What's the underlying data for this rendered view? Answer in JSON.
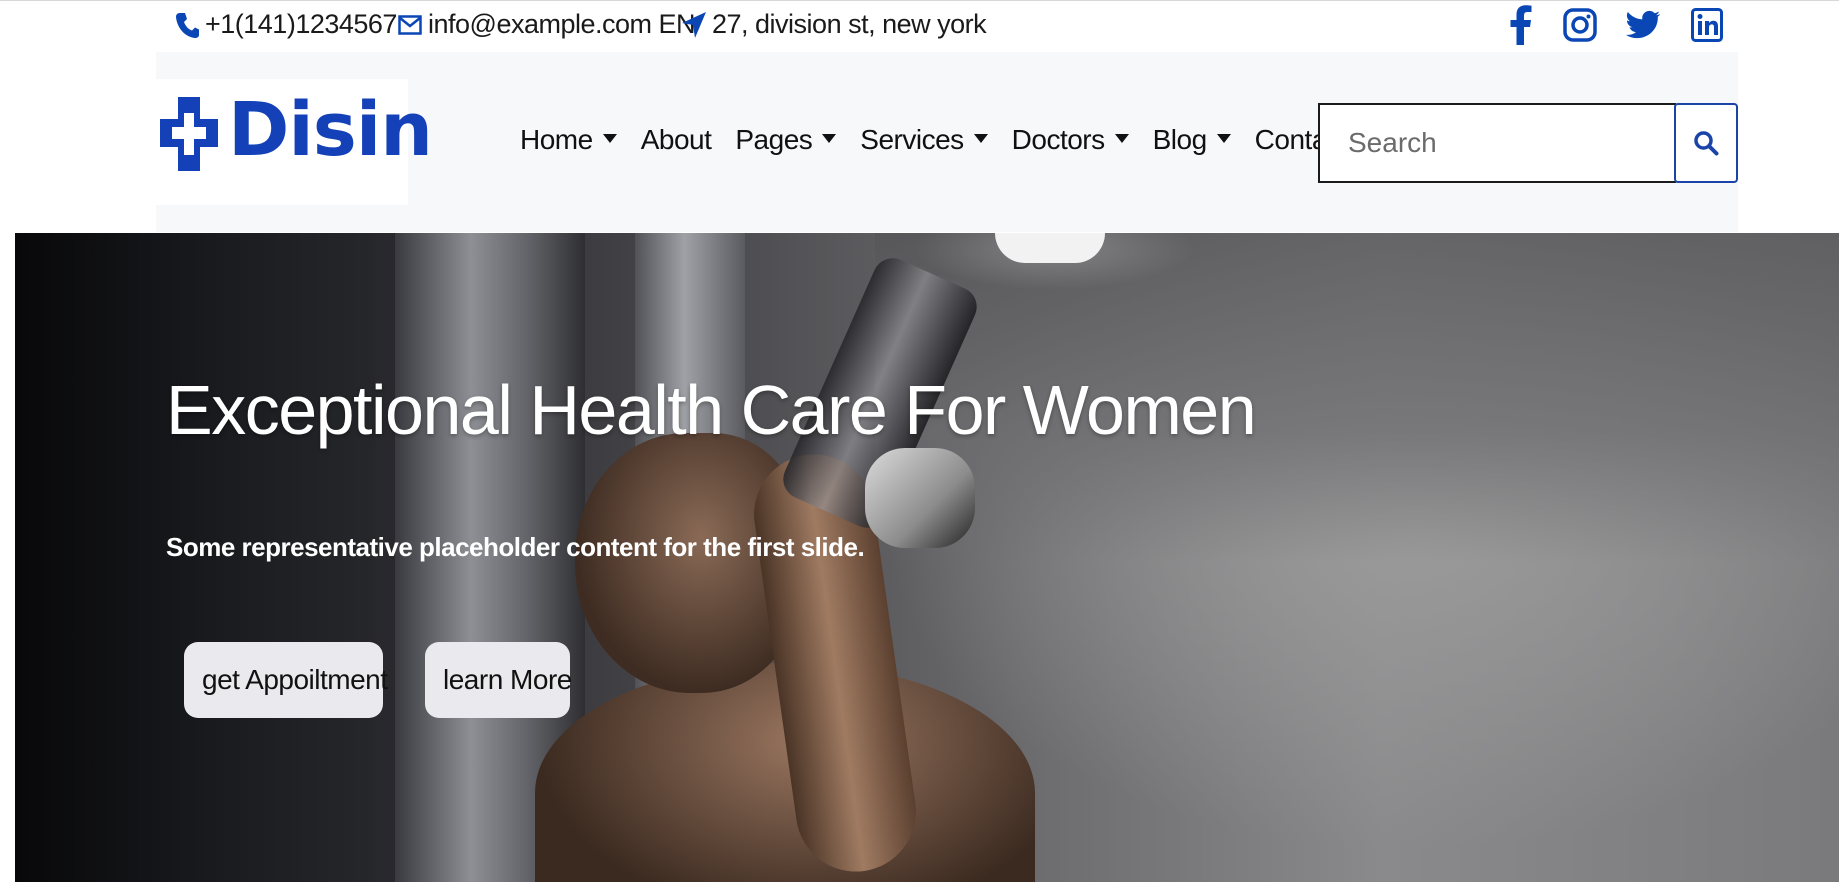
{
  "topbar": {
    "phone": "+1(141)1234567",
    "email": "info@example.com EN",
    "address": "27, division st, new york",
    "social_icons": [
      "facebook-icon",
      "instagram-icon",
      "twitter-icon",
      "linkedin-icon"
    ],
    "icon_color": "#0a47b5"
  },
  "header": {
    "logo_text": "Disin",
    "brand_color": "#1440b8",
    "nav": [
      {
        "label": "Home",
        "dropdown": true
      },
      {
        "label": "About",
        "dropdown": false
      },
      {
        "label": "Pages",
        "dropdown": true
      },
      {
        "label": "Services",
        "dropdown": true
      },
      {
        "label": "Doctors",
        "dropdown": true
      },
      {
        "label": "Blog",
        "dropdown": true
      },
      {
        "label": "Contact",
        "dropdown": false
      }
    ],
    "search": {
      "placeholder": "Search",
      "value": ""
    }
  },
  "hero": {
    "title": "Exceptional Health Care For Women",
    "subtitle": "Some representative placeholder content for the first slide.",
    "buttons": {
      "appointment": "get Appoiltment",
      "learn_more": "learn More"
    }
  }
}
